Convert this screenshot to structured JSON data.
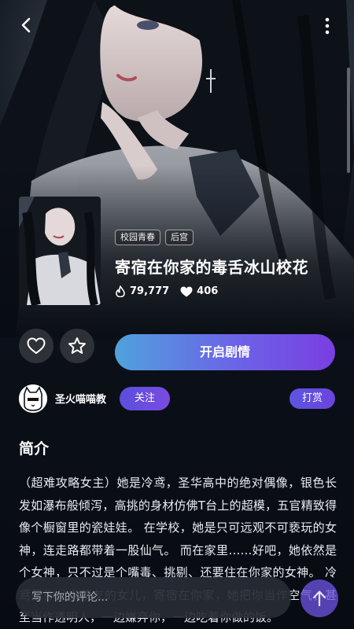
{
  "book": {
    "tags": [
      "校园青春",
      "后宫"
    ],
    "title": "寄宿在你家的毒舌冰山校花",
    "heat": "79,777",
    "likes": "406"
  },
  "actions": {
    "start_label": "开启剧情"
  },
  "author": {
    "name": "圣火喵喵教",
    "follow_label": "关注",
    "tip_label": "打赏"
  },
  "intro": {
    "heading": "简介",
    "text": "（超难攻略女主）她是冷鸢，圣华高中的绝对偶像，银色长发如瀑布般倾泻，高挑的身材仿佛T台上的超模，五官精致得像个橱窗里的瓷娃娃。 在学校，她是只可远观不可亵玩的女神，连走路都带着一股仙气。 而在家里……好吧，她依然是个女神，只不过是个嘴毒、挑剔、还要住在你家的女神。 冷鸢是你父亲挚友的女儿，寄宿在你家，她把你当作空气，甚至当作透明人，一边嫌弃你，一边吃着你做的饭。"
  },
  "comment": {
    "placeholder": "写下你的评论..."
  },
  "icons": {
    "back": "chevron-left-icon",
    "more": "more-vertical-icon",
    "heat": "flame-icon",
    "likes": "heart-icon",
    "like_button": "heart-outline-icon",
    "favorite_button": "star-outline-icon",
    "top_button": "arrow-up-icon"
  },
  "colors": {
    "accent_start": "#4fa2dc",
    "accent_end": "#7a3fe0",
    "background": "#080c13"
  }
}
